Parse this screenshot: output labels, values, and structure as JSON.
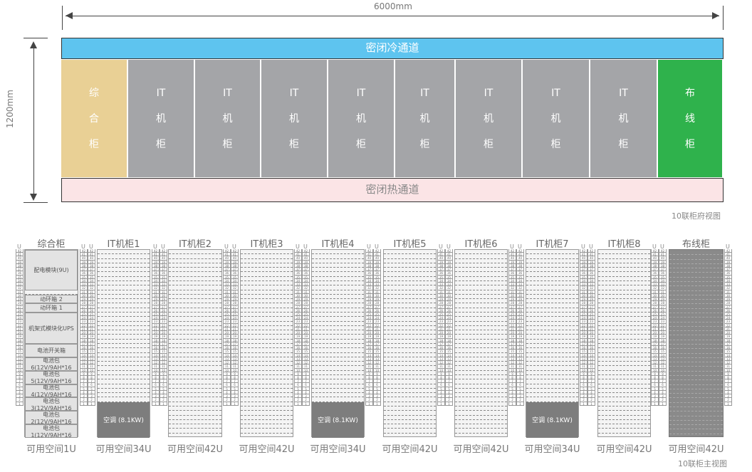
{
  "top_view": {
    "width_label": "6000mm",
    "height_label": "1200mm",
    "cold_aisle": "密闭冷通道",
    "hot_aisle": "密闭热通道",
    "caption": "10联柜府视图",
    "cabinets": [
      {
        "lines": [
          "综",
          "合",
          "柜"
        ],
        "color": "#e9d095"
      },
      {
        "lines": [
          "IT",
          "机",
          "柜"
        ],
        "color": "#a4a5a8"
      },
      {
        "lines": [
          "IT",
          "机",
          "柜"
        ],
        "color": "#a4a5a8"
      },
      {
        "lines": [
          "IT",
          "机",
          "柜"
        ],
        "color": "#a4a5a8"
      },
      {
        "lines": [
          "IT",
          "机",
          "柜"
        ],
        "color": "#a4a5a8"
      },
      {
        "lines": [
          "IT",
          "机",
          "柜"
        ],
        "color": "#a4a5a8"
      },
      {
        "lines": [
          "IT",
          "机",
          "柜"
        ],
        "color": "#a4a5a8"
      },
      {
        "lines": [
          "IT",
          "机",
          "柜"
        ],
        "color": "#a4a5a8"
      },
      {
        "lines": [
          "IT",
          "机",
          "柜"
        ],
        "color": "#a4a5a8"
      },
      {
        "lines": [
          "布",
          "线",
          "柜"
        ],
        "color": "#2fb24c"
      }
    ]
  },
  "front_view": {
    "caption": "10联柜主视图",
    "u_marker": "U",
    "total_units": 42,
    "cabinets": [
      {
        "name": "综合柜",
        "space": "可用空间1U"
      },
      {
        "name": "IT机柜1",
        "space": "可用空间34U"
      },
      {
        "name": "IT机柜2",
        "space": "可用空间42U"
      },
      {
        "name": "IT机柜3",
        "space": "可用空间42U"
      },
      {
        "name": "IT机柜4",
        "space": "可用空间34U"
      },
      {
        "name": "IT机柜5",
        "space": "可用空间42U"
      },
      {
        "name": "IT机柜6",
        "space": "可用空间42U"
      },
      {
        "name": "IT机柜7",
        "space": "可用空间34U"
      },
      {
        "name": "IT机柜8",
        "space": "可用空间42U"
      },
      {
        "name": "布线柜",
        "space": "可用空间42U"
      }
    ],
    "combo_modules": [
      {
        "label": "配电模块(9U)",
        "top_u": 42,
        "units": 9
      },
      {
        "label": "动环箱 2",
        "top_u": 32,
        "units": 2
      },
      {
        "label": "动环箱 1",
        "top_u": 30,
        "units": 2
      },
      {
        "label": "机架式模块化UPS",
        "top_u": 28,
        "units": 7
      },
      {
        "label": "电池开关箱",
        "top_u": 21,
        "units": 3
      },
      {
        "label": "电池包6(12V/9AH*16",
        "top_u": 18,
        "units": 3
      },
      {
        "label": "电池包5(12V/9AH*16",
        "top_u": 15,
        "units": 3
      },
      {
        "label": "电池包4(12V/9AH*16",
        "top_u": 12,
        "units": 3
      },
      {
        "label": "电池包3(12V/9AH*16",
        "top_u": 9,
        "units": 3
      },
      {
        "label": "电池包2(12V/9AH*16",
        "top_u": 6,
        "units": 3
      },
      {
        "label": "电池包1(12V/9AH*16",
        "top_u": 3,
        "units": 3
      }
    ],
    "ac_unit_label": "空调 (8.1KW)",
    "ac_units": 8
  }
}
